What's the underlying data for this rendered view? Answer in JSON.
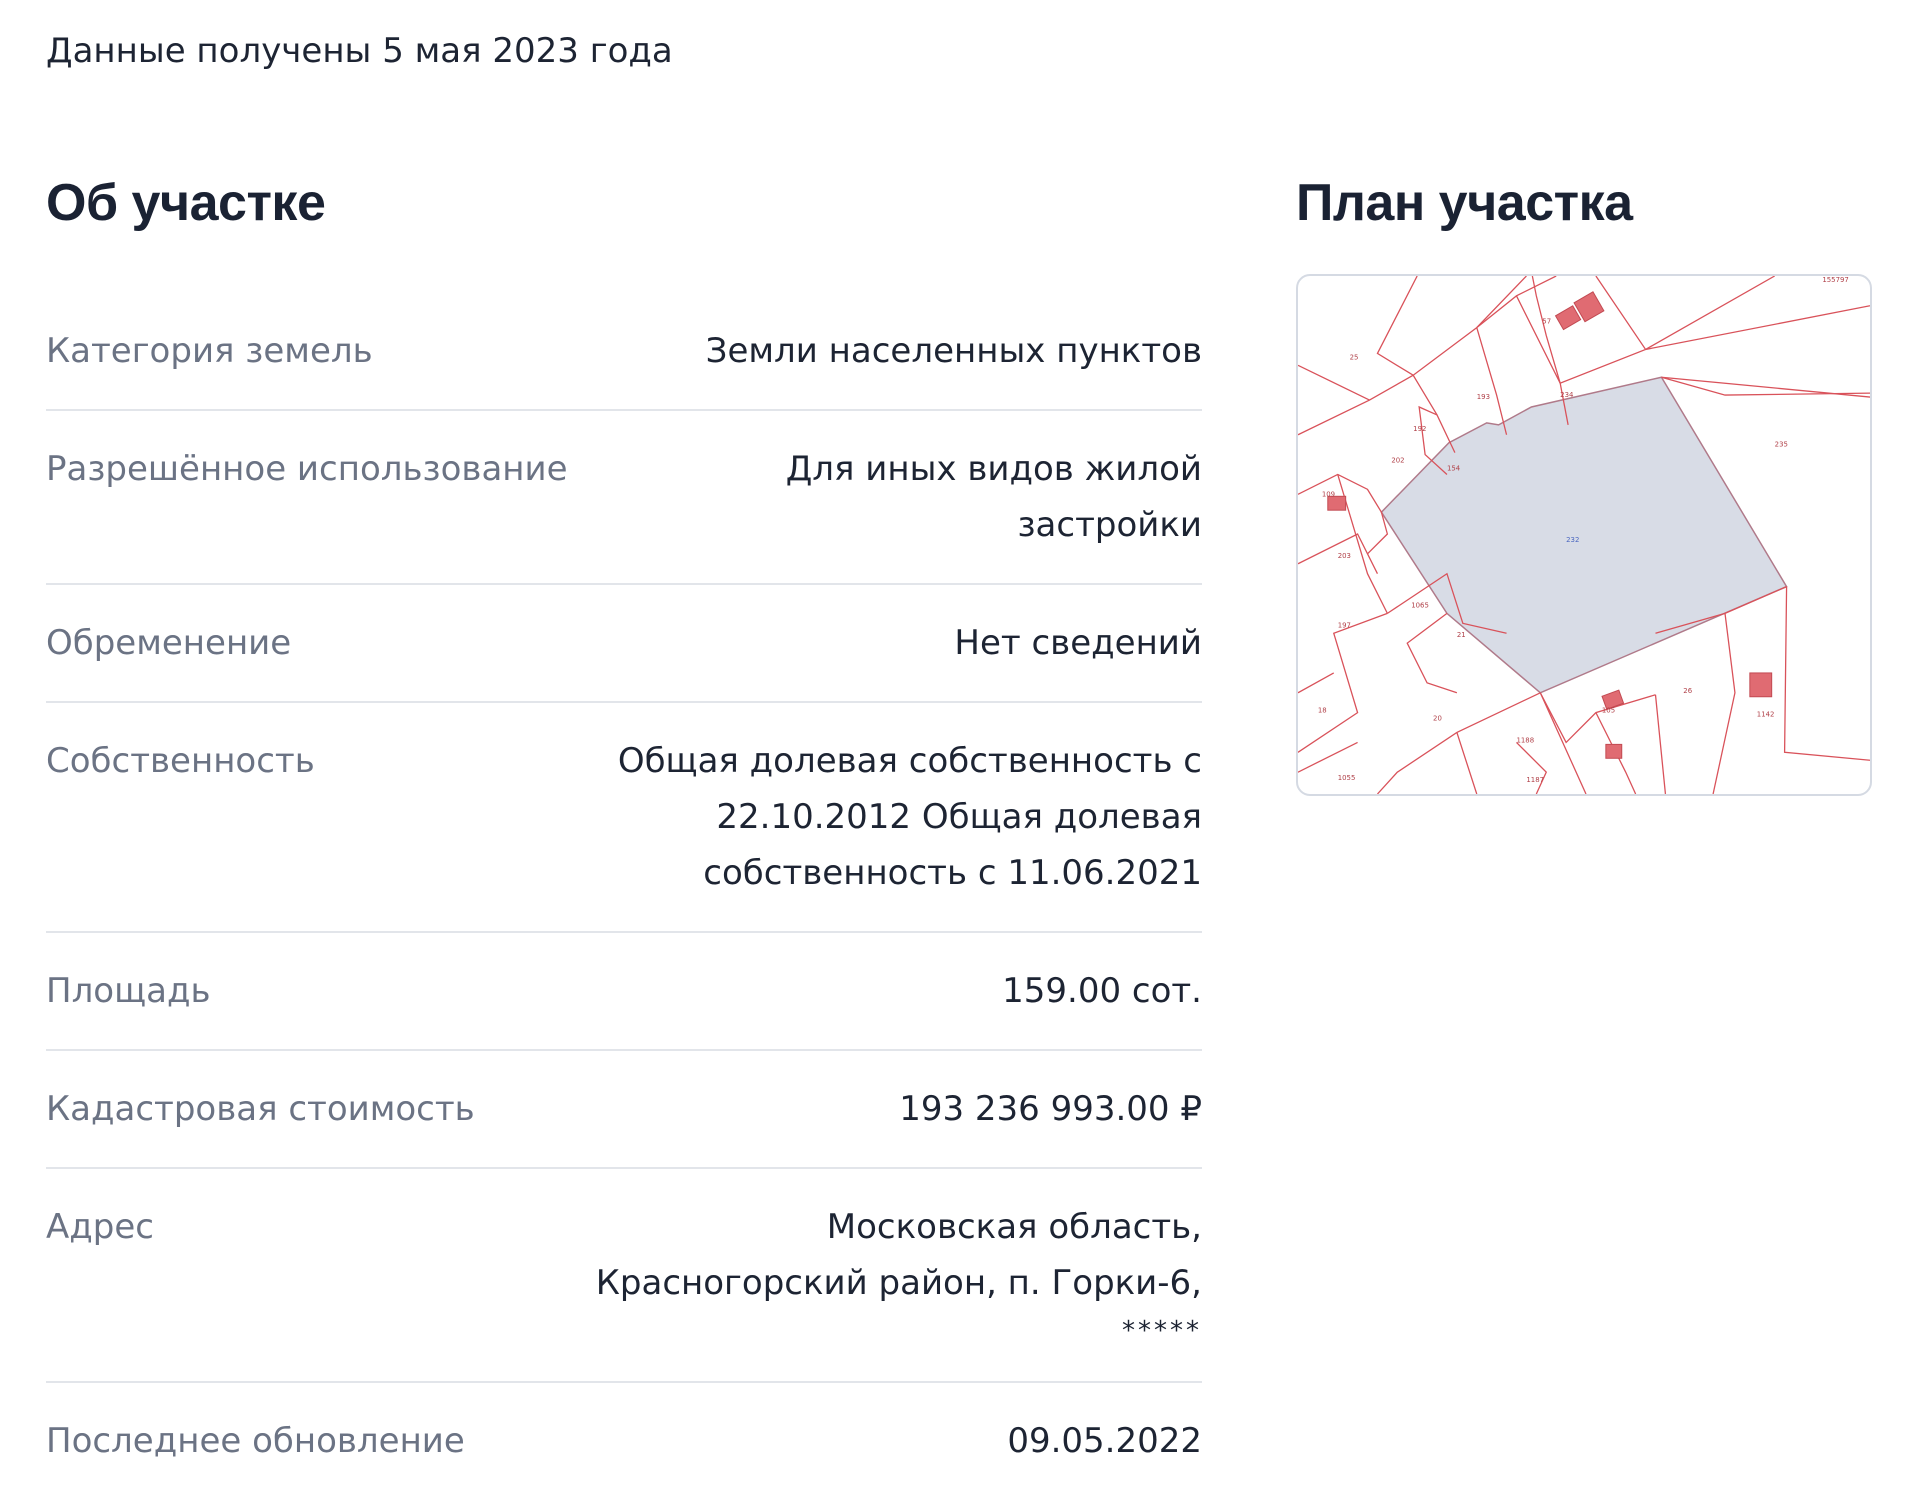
{
  "data_received": "Данные получены 5 мая 2023 года",
  "about": {
    "title": "Об участке",
    "rows": [
      {
        "label": "Категория земель",
        "value": "Земли населенных пунктов"
      },
      {
        "label": "Разрешённое использование",
        "value": "Для иных видов жилой застройки"
      },
      {
        "label": "Обременение",
        "value": "Нет сведений"
      },
      {
        "label": "Собственность",
        "value": "Общая долевая собственность с 22.10.2012 Общая долевая собственность с 11.06.2021"
      },
      {
        "label": "Площадь",
        "value": "159.00 сот."
      },
      {
        "label": "Кадастровая стоимость",
        "value": "193 236 993.00 ₽"
      },
      {
        "label": "Адрес",
        "value": "Московская область, Красногорский район, п. Горки-6,",
        "masked": "*****"
      },
      {
        "label": "Последнее обновление",
        "value": "09.05.2022"
      }
    ]
  },
  "plan": {
    "title": "План участка",
    "parcel_labels": [
      "155797",
      "25",
      "57",
      "193",
      "234",
      "235",
      "192",
      "202",
      "154",
      "109",
      "203",
      "1065",
      "197",
      "21",
      "20",
      "18",
      "105",
      "26",
      "1142",
      "1188",
      "1187",
      "1055",
      "232"
    ],
    "colors": {
      "boundary": "#d9525a",
      "parcel_fill": "#d8dce6",
      "parcel_stroke": "#b07a8a",
      "building_fill": "#e06b72"
    }
  }
}
